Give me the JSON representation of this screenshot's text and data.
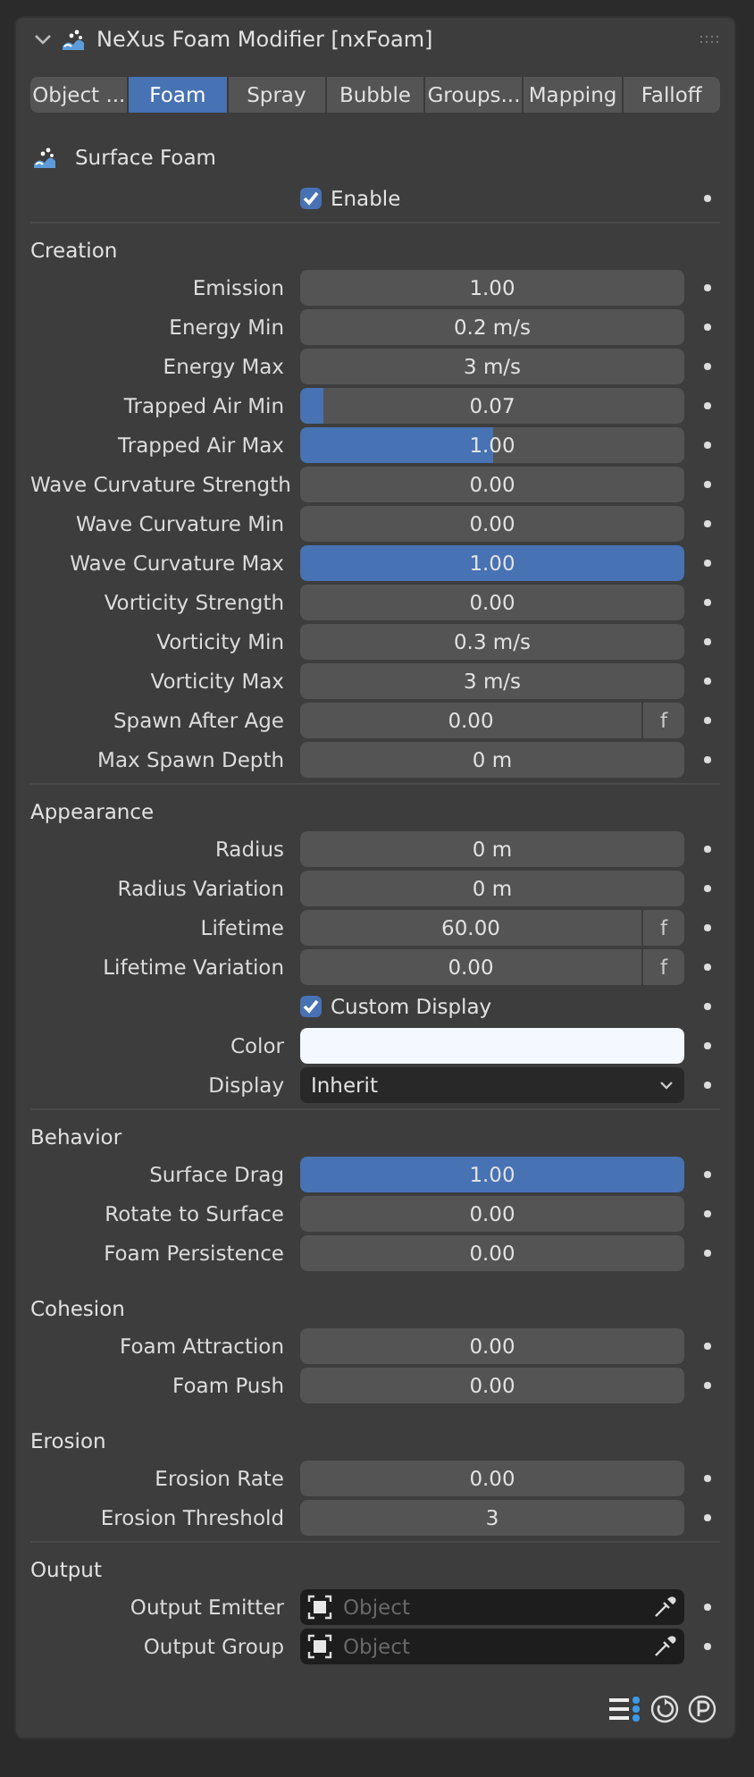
{
  "panel": {
    "title": "NeXus Foam Modifier [nxFoam]",
    "expanded": true
  },
  "tabs": [
    {
      "label": "Object ...",
      "selected": false
    },
    {
      "label": "Foam",
      "selected": true
    },
    {
      "label": "Spray",
      "selected": false
    },
    {
      "label": "Bubble",
      "selected": false
    },
    {
      "label": "Groups...",
      "selected": false
    },
    {
      "label": "Mapping",
      "selected": false
    },
    {
      "label": "Falloff",
      "selected": false
    }
  ],
  "subpanel": {
    "title": "Surface Foam"
  },
  "enable": {
    "label": "Enable",
    "checked": true
  },
  "sections": [
    {
      "title": "Creation",
      "divider": true,
      "rows": [
        {
          "kind": "number",
          "label": "Emission",
          "value": "1.00"
        },
        {
          "kind": "number",
          "label": "Energy Min",
          "value": "0.2 m/s"
        },
        {
          "kind": "number",
          "label": "Energy Max",
          "value": "3 m/s"
        },
        {
          "kind": "slider",
          "label": "Trapped Air Min",
          "value": "0.07",
          "level": 0.06
        },
        {
          "kind": "slider",
          "label": "Trapped Air Max",
          "value": "1.00",
          "level": 0.5
        },
        {
          "kind": "number",
          "label": "Wave Curvature Strength",
          "value": "0.00"
        },
        {
          "kind": "number",
          "label": "Wave Curvature Min",
          "value": "0.00"
        },
        {
          "kind": "slider",
          "label": "Wave Curvature Max",
          "value": "1.00",
          "level": 1
        },
        {
          "kind": "number",
          "label": "Vorticity Strength",
          "value": "0.00"
        },
        {
          "kind": "number",
          "label": "Vorticity Min",
          "value": "0.3 m/s"
        },
        {
          "kind": "number",
          "label": "Vorticity Max",
          "value": "3 m/s"
        },
        {
          "kind": "frames",
          "label": "Spawn After Age",
          "value": "0.00",
          "unit": "f"
        },
        {
          "kind": "number",
          "label": "Max Spawn Depth",
          "value": "0 m"
        }
      ]
    },
    {
      "title": "Appearance",
      "divider": true,
      "rows": [
        {
          "kind": "number",
          "label": "Radius",
          "value": "0 m"
        },
        {
          "kind": "number",
          "label": "Radius Variation",
          "value": "0 m"
        },
        {
          "kind": "frames",
          "label": "Lifetime",
          "value": "60.00",
          "unit": "f"
        },
        {
          "kind": "frames",
          "label": "Lifetime Variation",
          "value": "0.00",
          "unit": "f"
        },
        {
          "kind": "checkbox",
          "label": "Custom Display",
          "checked": true
        },
        {
          "kind": "color",
          "label": "Color",
          "color": "#f4f8ff"
        },
        {
          "kind": "dropdown",
          "label": "Display",
          "value": "Inherit"
        }
      ]
    },
    {
      "title": "Behavior",
      "divider": true,
      "rows": [
        {
          "kind": "slider",
          "label": "Surface Drag",
          "value": "1.00",
          "level": 1
        },
        {
          "kind": "number",
          "label": "Rotate to Surface",
          "value": "0.00"
        },
        {
          "kind": "number",
          "label": "Foam Persistence",
          "value": "0.00"
        }
      ]
    },
    {
      "title": "Cohesion",
      "divider": false,
      "rows": [
        {
          "kind": "number",
          "label": "Foam Attraction",
          "value": "0.00"
        },
        {
          "kind": "number",
          "label": "Foam Push",
          "value": "0.00"
        }
      ]
    },
    {
      "title": "Erosion",
      "divider": false,
      "rows": [
        {
          "kind": "number",
          "label": "Erosion Rate",
          "value": "0.00"
        },
        {
          "kind": "number",
          "label": "Erosion Threshold",
          "value": "3"
        }
      ]
    },
    {
      "title": "Output",
      "divider": true,
      "rows": [
        {
          "kind": "object",
          "label": "Output Emitter",
          "placeholder": "Object"
        },
        {
          "kind": "object",
          "label": "Output Group",
          "placeholder": "Object"
        }
      ]
    }
  ]
}
